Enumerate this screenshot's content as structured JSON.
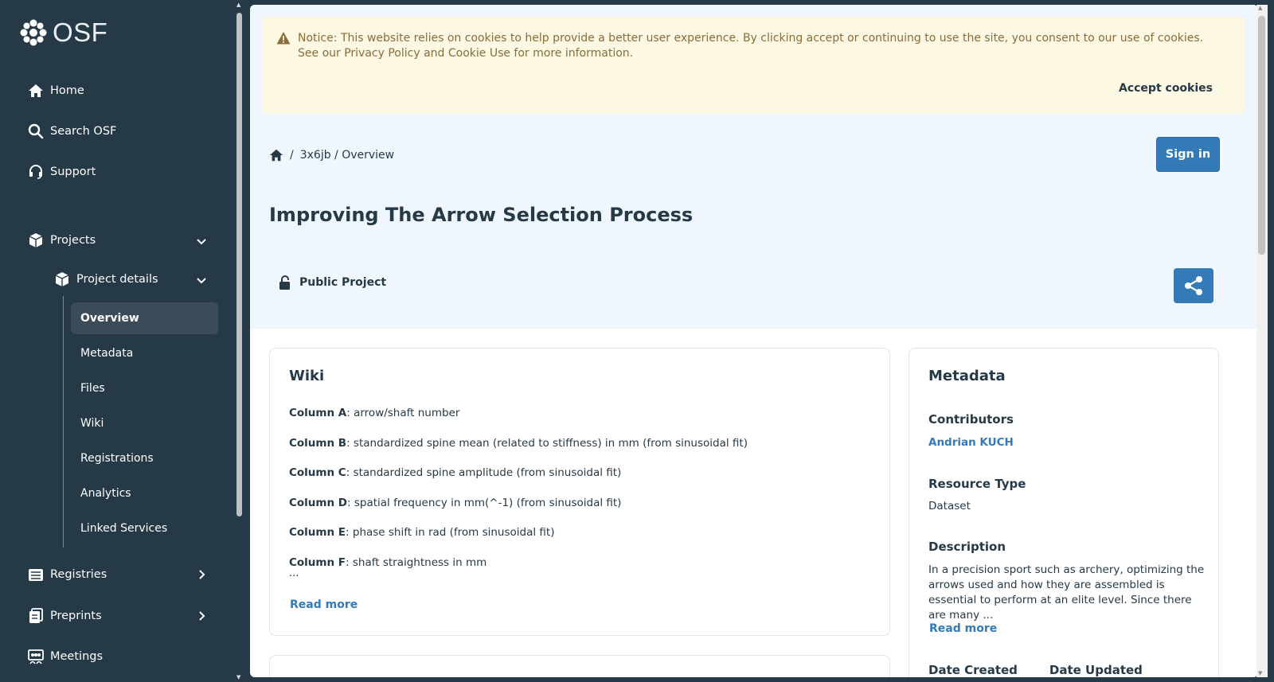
{
  "sidebar": {
    "logo_text": "OSF",
    "nav": {
      "home": "Home",
      "search": "Search OSF",
      "support": "Support",
      "projects": "Projects",
      "project_details": "Project details",
      "registries": "Registries",
      "preprints": "Preprints",
      "meetings": "Meetings"
    },
    "project_items": [
      {
        "label": "Overview",
        "active": true
      },
      {
        "label": "Metadata"
      },
      {
        "label": "Files"
      },
      {
        "label": "Wiki"
      },
      {
        "label": "Registrations"
      },
      {
        "label": "Analytics"
      },
      {
        "label": "Linked Services"
      }
    ]
  },
  "cookie": {
    "message": "Notice: This website relies on cookies to help provide a better user experience. By clicking accept or continuing to use the site, you consent to our use of cookies. See our Privacy Policy and Cookie Use for more information.",
    "accept_label": "Accept cookies"
  },
  "breadcrumb": {
    "separator": "/",
    "path": "3x6jb / Overview"
  },
  "signin_label": "Sign in",
  "project": {
    "title": "Improving The Arrow Selection Process",
    "visibility": "Public Project"
  },
  "wiki": {
    "heading": "Wiki",
    "lines": [
      {
        "key": "Column A",
        "text": ": arrow/shaft number"
      },
      {
        "key": "Column B",
        "text": ": standardized spine mean (related to stiffness) in mm  (from sinusoidal fit)"
      },
      {
        "key": "Column C",
        "text": ": standardized spine amplitude  (from sinusoidal fit)"
      },
      {
        "key": "Column D",
        "text": ": spatial frequency in mm(^-1)  (from sinusoidal fit)"
      },
      {
        "key": "Column E",
        "text": ": phase shift in rad  (from sinusoidal fit)"
      },
      {
        "key": "Column F",
        "text": ": shaft straightness in mm"
      }
    ],
    "ellipsis": "...",
    "read_more": "Read more"
  },
  "metadata": {
    "heading": "Metadata",
    "contributors_label": "Contributors",
    "contributor": "Andrian KUCH",
    "resource_type_label": "Resource Type",
    "resource_type": "Dataset",
    "description_label": "Description",
    "description": "In a precision sport such as archery, optimizing the arrows used and how they are assembled is essential to perform at an elite level. Since there are many ...",
    "read_more": "Read more",
    "date_created_label": "Date Created",
    "date_updated_label": "Date Updated"
  },
  "colors": {
    "sidebar_bg": "#263947",
    "accent": "#337ab7",
    "notice_bg": "#fcf8e3",
    "notice_text": "#8a6d3b",
    "header_bg": "#eff6fd"
  }
}
